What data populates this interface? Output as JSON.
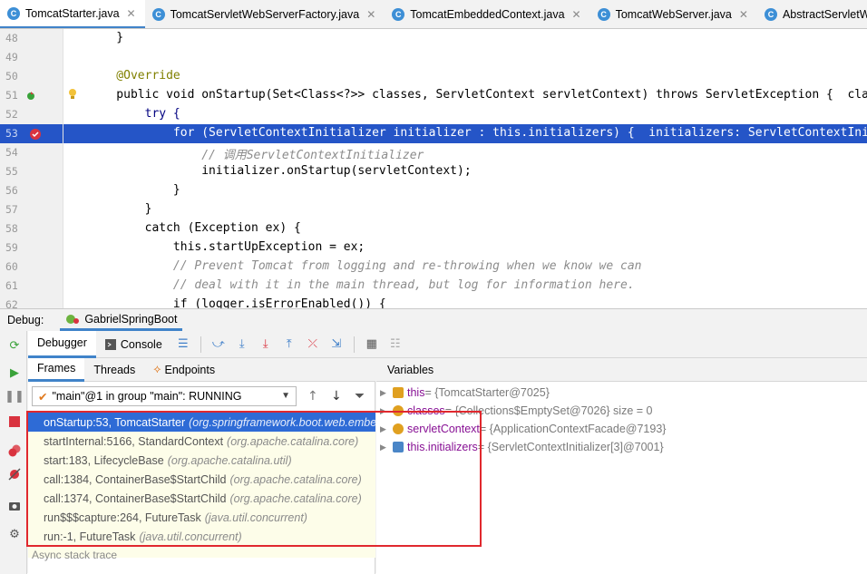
{
  "tabs": [
    {
      "label": "TomcatStarter.java",
      "active": true
    },
    {
      "label": "TomcatServletWebServerFactory.java",
      "active": false
    },
    {
      "label": "TomcatEmbeddedContext.java",
      "active": false
    },
    {
      "label": "TomcatWebServer.java",
      "active": false
    },
    {
      "label": "AbstractServletW",
      "active": false
    }
  ],
  "class_badge": "C",
  "close_glyph": "✕",
  "editor": {
    "lines": [
      {
        "num": "48",
        "text": "    }"
      },
      {
        "num": "49",
        "text": ""
      },
      {
        "num": "50",
        "text": "    @Override"
      },
      {
        "num": "51",
        "text": "    public void onStartup(Set<Class<?>> classes, ServletContext servletContext) throws ServletException {  classes"
      },
      {
        "num": "52",
        "text": "        try {"
      },
      {
        "num": "53",
        "text": "            for (ServletContextInitializer initializer : this.initializers) {  initializers: ServletContextIniti"
      },
      {
        "num": "54",
        "text": "                // 调用ServletContextInitializer"
      },
      {
        "num": "55",
        "text": "                initializer.onStartup(servletContext);"
      },
      {
        "num": "56",
        "text": "            }"
      },
      {
        "num": "57",
        "text": "        }"
      },
      {
        "num": "58",
        "text": "        catch (Exception ex) {"
      },
      {
        "num": "59",
        "text": "            this.startUpException = ex;"
      },
      {
        "num": "60",
        "text": "            // Prevent Tomcat from logging and re-throwing when we know we can"
      },
      {
        "num": "61",
        "text": "            // deal with it in the main thread, but log for information here."
      },
      {
        "num": "62",
        "text": "            if (logger.isErrorEnabled()) {"
      }
    ]
  },
  "debug": {
    "label": "Debug:",
    "run_config": "GabrielSpringBoot",
    "tool_tabs": [
      {
        "label": "Debugger",
        "active": true
      },
      {
        "label": "Console",
        "active": false
      }
    ],
    "sub_tabs": [
      {
        "label": "Frames",
        "active": true
      },
      {
        "label": "Threads",
        "active": false
      },
      {
        "label": "Endpoints",
        "active": false
      }
    ],
    "thread_selector": "\"main\"@1 in group \"main\": RUNNING",
    "frames": [
      {
        "method": "onStartup:53, TomcatStarter",
        "pkg": "(org.springframework.boot.web.embedded.tomcat)",
        "selected": true
      },
      {
        "method": "startInternal:5166, StandardContext",
        "pkg": "(org.apache.catalina.core)",
        "selected": false
      },
      {
        "method": "start:183, LifecycleBase",
        "pkg": "(org.apache.catalina.util)",
        "selected": false
      },
      {
        "method": "call:1384, ContainerBase$StartChild",
        "pkg": "(org.apache.catalina.core)",
        "selected": false
      },
      {
        "method": "call:1374, ContainerBase$StartChild",
        "pkg": "(org.apache.catalina.core)",
        "selected": false
      },
      {
        "method": "run$$$capture:264, FutureTask",
        "pkg": "(java.util.concurrent)",
        "selected": false
      },
      {
        "method": "run:-1, FutureTask",
        "pkg": "(java.util.concurrent)",
        "selected": false
      }
    ],
    "async_label": "Async stack trace",
    "variables_header": "Variables",
    "variables": [
      {
        "name": "this",
        "value": " = {TomcatStarter@7025}",
        "color": "#e0a020"
      },
      {
        "name": "classes",
        "value": " = {Collections$EmptySet@7026}  size = 0",
        "color": "#e0a020"
      },
      {
        "name": "servletContext",
        "value": " = {ApplicationContextFacade@7193}",
        "color": "#e0a020"
      },
      {
        "name": "this.initializers",
        "value": " = {ServletContextInitializer[3]@7001}",
        "color": "#4a86c7"
      }
    ]
  },
  "colors": {
    "accent": "#4083c9",
    "selection": "#2555c7",
    "highlight_box": "#e0282e"
  }
}
